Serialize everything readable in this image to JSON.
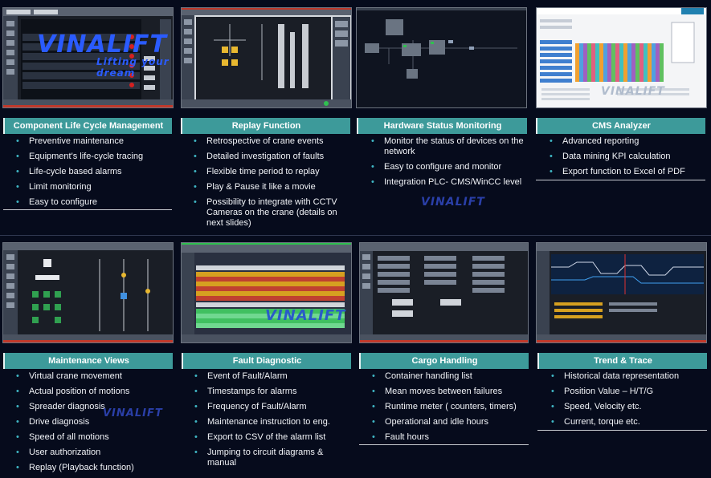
{
  "watermark": {
    "brand": "VINALIFT",
    "tagline": "Lifting your dream"
  },
  "colors": {
    "header_bg": "#3d9a9a",
    "page_bg": "#060b1c",
    "bullet": "#3fb6c4"
  },
  "sections": [
    {
      "title": "Component Life Cycle Management",
      "items": [
        "Preventive maintenance",
        "Equipment's life-cycle tracing",
        "Life-cycle based  alarms",
        "Limit monitoring",
        "Easy to configure"
      ]
    },
    {
      "title": "Replay Function",
      "items": [
        "Retrospective of crane events",
        "Detailed investigation of faults",
        "Flexible time period to replay",
        "Play & Pause it like a movie",
        "Possibility to integrate with CCTV Cameras on the crane (details on next slides)"
      ]
    },
    {
      "title": "Hardware Status Monitoring",
      "items": [
        "Monitor the status of devices on the network",
        "Easy to configure and monitor",
        "Integration PLC- CMS/WinCC level"
      ]
    },
    {
      "title": "CMS Analyzer",
      "items": [
        "Advanced reporting",
        "Data mining KPI calculation",
        "Export function to Excel of PDF"
      ]
    },
    {
      "title": "Maintenance Views",
      "items": [
        "Virtual crane movement",
        "Actual position of motions",
        "Spreader diagnosis",
        "Drive diagnosis",
        "Speed of all motions",
        "User authorization",
        "Replay (Playback function)"
      ]
    },
    {
      "title": "Fault Diagnostic",
      "items": [
        "Event of Fault/Alarm",
        "Timestamps for alarms",
        "Frequency of Fault/Alarm",
        "Maintenance instruction to eng.",
        "Export to CSV of the alarm list",
        "Jumping to circuit diagrams & manual"
      ]
    },
    {
      "title": "Cargo Handling",
      "items": [
        "Container handling list",
        "Mean moves between failures",
        "Runtime meter ( counters, timers)",
        "Operational and idle hours",
        "Fault hours"
      ]
    },
    {
      "title": "Trend & Trace",
      "items": [
        "Historical data representation",
        "Position Value – H/T/G",
        "Speed, Velocity etc.",
        "Current, torque etc."
      ]
    }
  ],
  "screenshots": {
    "s1": {
      "name": "component-life-cycle-screenshot"
    },
    "s2": {
      "name": "replay-function-screenshot"
    },
    "s3": {
      "name": "hardware-status-screenshot"
    },
    "s4": {
      "name": "cms-analyzer-screenshot"
    },
    "s5": {
      "name": "maintenance-views-screenshot"
    },
    "s6": {
      "name": "fault-diagnostic-screenshot"
    },
    "s7": {
      "name": "cargo-handling-screenshot"
    },
    "s8": {
      "name": "trend-trace-screenshot"
    }
  }
}
